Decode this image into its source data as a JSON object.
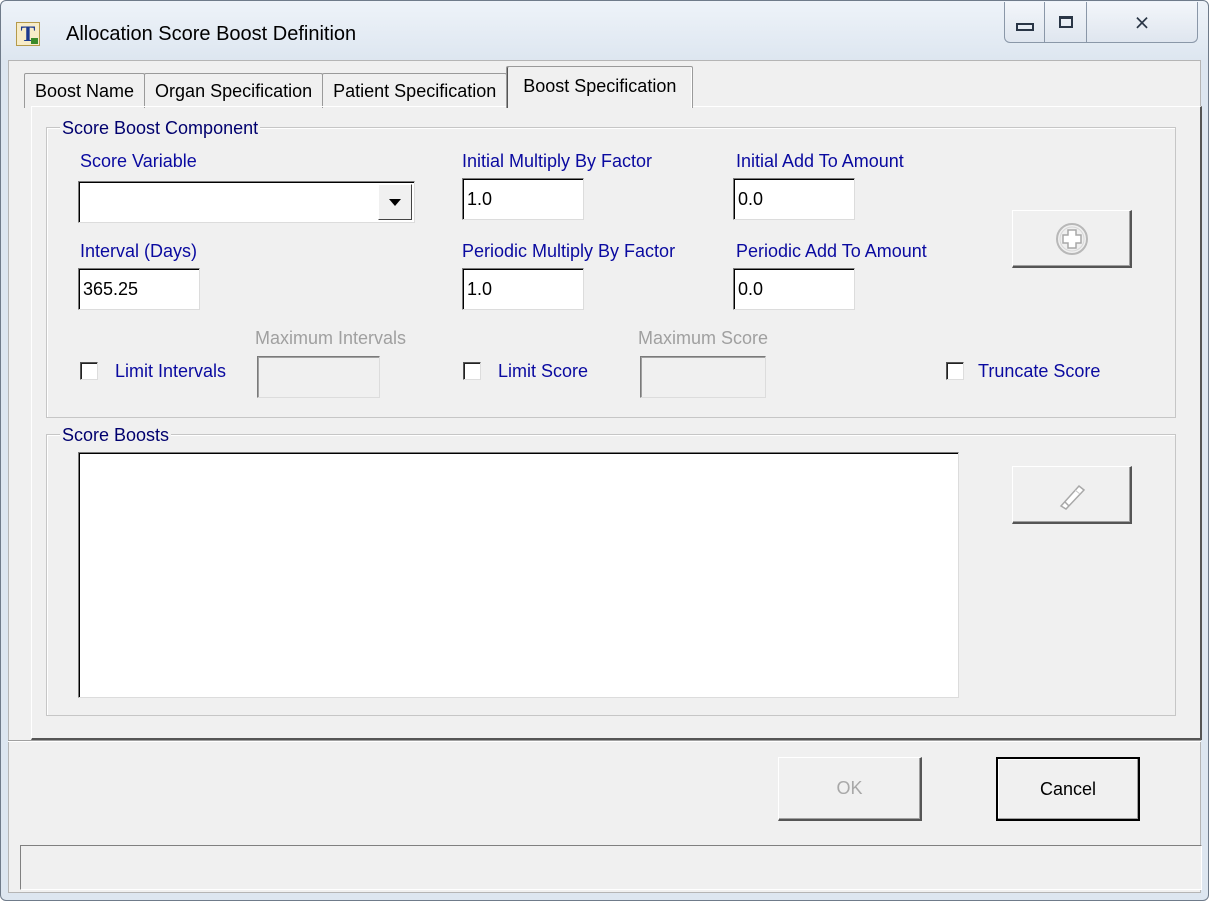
{
  "window": {
    "title": "Allocation Score Boost Definition",
    "app_icon": "T",
    "caption_buttons": {
      "minimize": "minimize-icon",
      "maximize": "maximize-icon",
      "close": "close-icon"
    }
  },
  "tabs": [
    {
      "label": "Boost Name",
      "active": false
    },
    {
      "label": "Organ Specification",
      "active": false
    },
    {
      "label": "Patient Specification",
      "active": false
    },
    {
      "label": "Boost Specification",
      "active": true
    }
  ],
  "component": {
    "legend": "Score Boost Component",
    "score_variable_label": "Score Variable",
    "score_variable_value": "",
    "initial_multiply_label": "Initial Multiply By Factor",
    "initial_multiply_value": "1.0",
    "initial_add_label": "Initial Add To Amount",
    "initial_add_value": "0.0",
    "interval_label": "Interval (Days)",
    "interval_value": "365.25",
    "periodic_multiply_label": "Periodic Multiply By Factor",
    "periodic_multiply_value": "1.0",
    "periodic_add_label": "Periodic Add To Amount",
    "periodic_add_value": "0.0",
    "max_intervals_label": "Maximum Intervals",
    "max_intervals_value": "",
    "limit_intervals_label": "Limit Intervals",
    "limit_intervals_checked": false,
    "limit_score_label": "Limit Score",
    "limit_score_checked": false,
    "max_score_label": "Maximum Score",
    "max_score_value": "",
    "truncate_score_label": "Truncate Score",
    "truncate_score_checked": false,
    "add_button_icon": "plus-circle-icon"
  },
  "boosts": {
    "legend": "Score Boosts",
    "items": [],
    "remove_button_icon": "eraser-icon"
  },
  "footer": {
    "ok_label": "OK",
    "cancel_label": "Cancel",
    "status_text": ""
  }
}
